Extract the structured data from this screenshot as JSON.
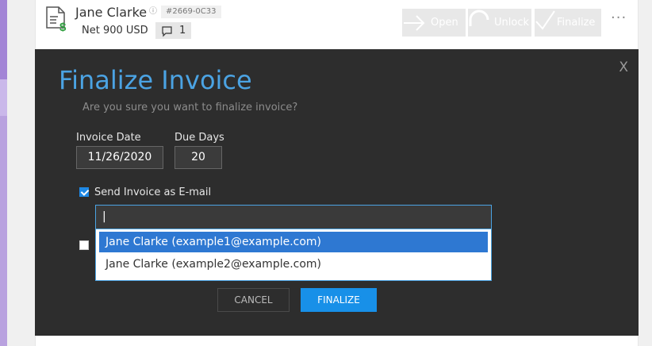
{
  "header": {
    "client_name": "Jane Clarke",
    "invoice_id": "#2669-0C33",
    "net_amount": "Net 900 USD",
    "comment_count": "1",
    "open_label": "Open",
    "unlock_label": "Unlock",
    "finalize_label": "Finalize",
    "more_icon": "···",
    "info_icon": "ⓘ"
  },
  "dialog": {
    "close_label": "X",
    "title": "Finalize Invoice",
    "subtitle": "Are you sure you want to finalize invoice?",
    "invoice_date_label": "Invoice Date",
    "invoice_date_value": "11/26/2020",
    "due_days_label": "Due Days",
    "due_days_value": "20",
    "send_email_label": "Send Invoice as E-mail",
    "send_email_checked": true,
    "email_input_value": "|",
    "email_suggestions": [
      "Jane Clarke (example1@example.com)",
      "Jane Clarke (example2@example.com)"
    ],
    "cancel_label": "CANCEL",
    "finalize_label": "FINALIZE"
  },
  "colors": {
    "accent": "#4ba3e3",
    "primary_button": "#1890e8",
    "dialog_bg": "#2d2d2d",
    "selected_item": "#2e78d2",
    "money_green": "#2e9e3e",
    "sidebar_purple": "#a385d6"
  }
}
